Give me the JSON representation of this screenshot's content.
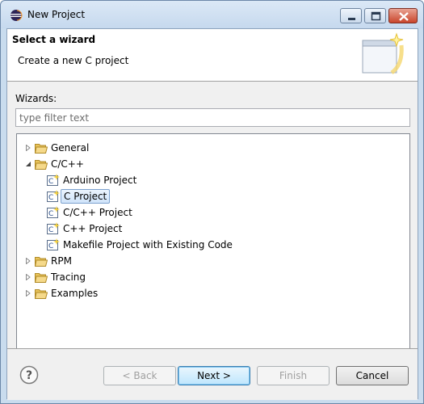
{
  "window": {
    "title": "New Project"
  },
  "header": {
    "title": "Select a wizard",
    "description": "Create a new C project"
  },
  "wizards": {
    "label": "Wizards:",
    "filter_placeholder": "type filter text",
    "tree": {
      "general": "General",
      "cpp": "C/C++",
      "cpp_children": [
        "Arduino Project",
        "C Project",
        "C/C++ Project",
        "C++ Project",
        "Makefile Project with Existing Code"
      ],
      "selected": "C Project",
      "rpm": "RPM",
      "tracing": "Tracing",
      "examples": "Examples"
    }
  },
  "buttons": {
    "back": "< Back",
    "next": "Next >",
    "finish": "Finish",
    "cancel": "Cancel"
  },
  "colors": {
    "selection_border": "#7da2ce",
    "folder": "#e8c35a",
    "close_button": "#c9462c"
  }
}
